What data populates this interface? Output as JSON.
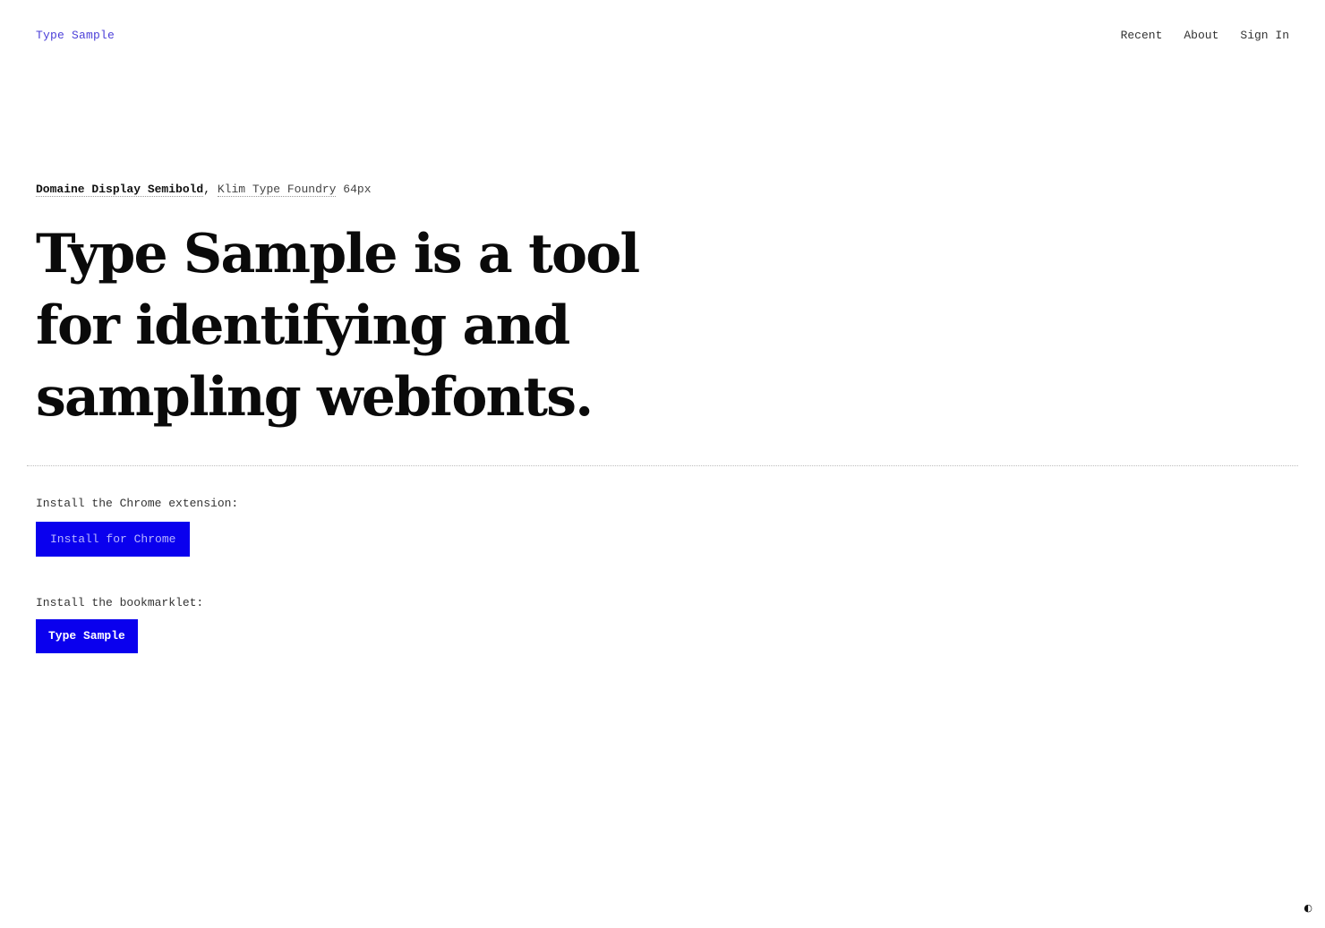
{
  "header": {
    "logo": "Type Sample",
    "nav": [
      {
        "label": "Recent"
      },
      {
        "label": "About"
      },
      {
        "label": "Sign In"
      }
    ]
  },
  "hero": {
    "font_name": "Domaine Display Semibold",
    "separator": ",",
    "foundry": "Klim Type Foundry",
    "font_size": "64px",
    "headline": "Type Sample is a tool for identifying and sampling webfonts."
  },
  "install": {
    "chrome_label": "Install the Chrome extension:",
    "chrome_button": "Install for Chrome",
    "bookmarklet_label": "Install the bookmarklet:",
    "bookmarklet_button": "Type Sample"
  },
  "footer": {
    "theme_toggle_icon": "◐",
    "theme_toggle_name": "contrast-toggle-icon"
  },
  "colors": {
    "accent_blue": "#0a00ee",
    "logo_purple": "#4b3fd8",
    "text": "#111111",
    "background": "#ffffff"
  }
}
